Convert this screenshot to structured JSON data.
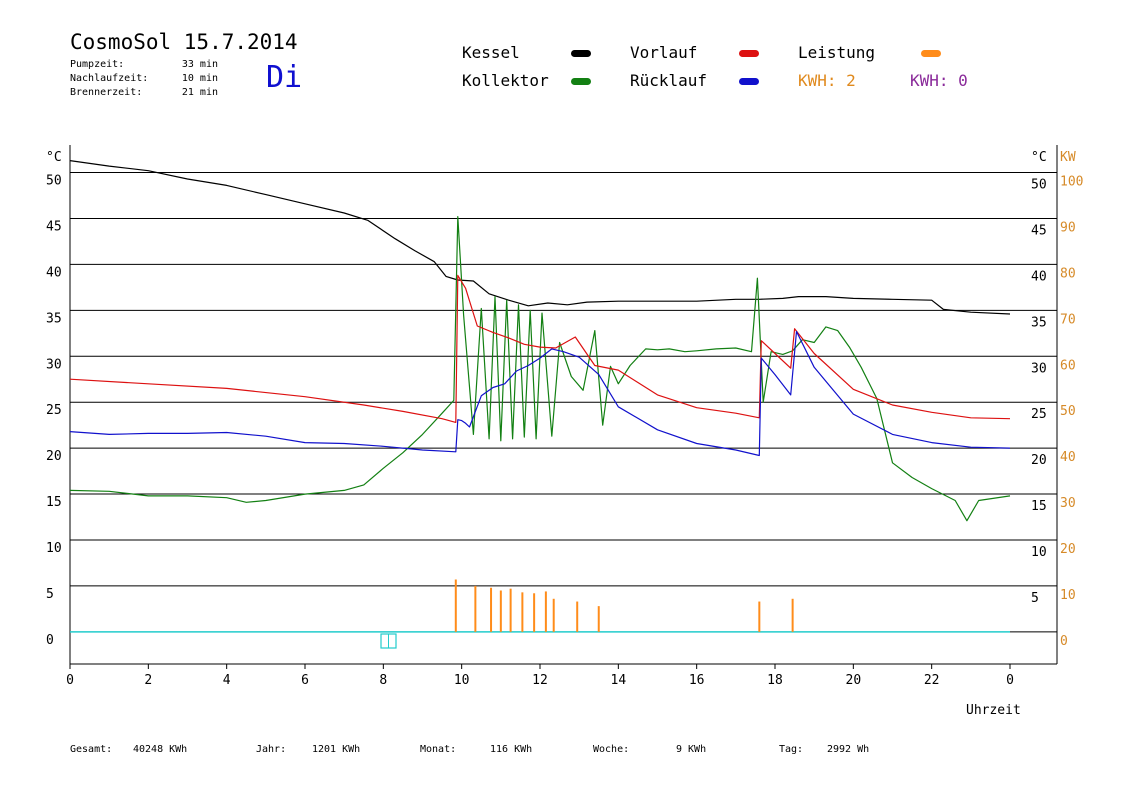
{
  "header": {
    "title": "CosmoSol 15.7.2014",
    "day": "Di",
    "stats": [
      {
        "label": "Pumpzeit:",
        "value": "33 min"
      },
      {
        "label": "Nachlaufzeit:",
        "value": "10 min"
      },
      {
        "label": "Brennerzeit:",
        "value": "21 min"
      }
    ]
  },
  "legend": {
    "items": [
      {
        "name": "Kessel",
        "color": "#000000"
      },
      {
        "name": "Kollektor",
        "color": "#138013"
      },
      {
        "name": "Vorlauf",
        "color": "#dd1111"
      },
      {
        "name": "Rücklauf",
        "color": "#1111cc"
      },
      {
        "name": "Leistung",
        "color": "#ff8c1a"
      }
    ],
    "kwh1": "KWH: 2",
    "kwh1_color": "#e08a1e",
    "kwh2": "KWH: 0",
    "kwh2_color": "#8a2a9a"
  },
  "footer": {
    "gesamt_label": "Gesamt:",
    "gesamt_value": "40248 KWh",
    "jahr_label": "Jahr:",
    "jahr_value": "1201 KWh",
    "monat_label": "Monat:",
    "monat_value": "116 KWh",
    "woche_label": "Woche:",
    "woche_value": "9 KWh",
    "tag_label": "Tag:",
    "tag_value": "2992 Wh"
  },
  "chart_data": {
    "type": "line",
    "title": "CosmoSol 15.7.2014",
    "xlabel": "Uhrzeit",
    "ylabel_left": "°C",
    "ylabel_right_1": "°C",
    "ylabel_right_2": "KW",
    "xlim": [
      0,
      24
    ],
    "ylim": [
      -3.5,
      53
    ],
    "grid": true,
    "x_ticks": [
      {
        "v": 0,
        "label": "0"
      },
      {
        "v": 2,
        "label": "2"
      },
      {
        "v": 4,
        "label": "4"
      },
      {
        "v": 6,
        "label": "6"
      },
      {
        "v": 8,
        "label": "8"
      },
      {
        "v": 10,
        "label": "10"
      },
      {
        "v": 12,
        "label": "12"
      },
      {
        "v": 14,
        "label": "14"
      },
      {
        "v": 16,
        "label": "16"
      },
      {
        "v": 18,
        "label": "18"
      },
      {
        "v": 20,
        "label": "20"
      },
      {
        "v": 22,
        "label": "22"
      },
      {
        "v": 24,
        "label": "0"
      }
    ],
    "y_left_ticks": [
      0,
      5,
      10,
      15,
      20,
      25,
      30,
      35,
      40,
      45,
      50
    ],
    "y_right_ticks": [
      5,
      10,
      15,
      20,
      25,
      30,
      35,
      40,
      45,
      50
    ],
    "kw_ticks": [
      0,
      10,
      20,
      30,
      40,
      50,
      60,
      70,
      80,
      90,
      100
    ],
    "series": [
      {
        "name": "Kessel",
        "color": "#000000",
        "x": [
          0,
          1,
          2,
          3,
          4,
          5,
          6,
          7,
          7.6,
          8.3,
          8.8,
          9.3,
          9.6,
          9.9,
          10.3,
          10.7,
          11.2,
          11.7,
          12.2,
          12.7,
          13.2,
          14,
          15,
          16,
          17,
          17.6,
          18.2,
          18.6,
          19.3,
          20,
          21,
          22,
          22.3,
          23,
          24
        ],
        "y": [
          51.3,
          50.7,
          50.2,
          49.3,
          48.6,
          47.6,
          46.6,
          45.6,
          44.8,
          42.8,
          41.5,
          40.3,
          38.7,
          38.3,
          38.2,
          36.8,
          36.1,
          35.5,
          35.8,
          35.6,
          35.9,
          36.0,
          36.0,
          36.0,
          36.2,
          36.2,
          36.3,
          36.5,
          36.5,
          36.3,
          36.2,
          36.1,
          35.1,
          34.8,
          34.6
        ]
      },
      {
        "name": "Kollektor",
        "color": "#138013",
        "x": [
          0,
          1,
          2,
          3,
          4,
          4.5,
          5,
          6,
          7,
          7.5,
          8,
          8.5,
          9,
          9.5,
          9.8,
          9.9,
          10.05,
          10.3,
          10.5,
          10.7,
          10.85,
          11,
          11.15,
          11.3,
          11.45,
          11.6,
          11.75,
          11.9,
          12.05,
          12.3,
          12.5,
          12.8,
          13.1,
          13.4,
          13.6,
          13.8,
          14,
          14.3,
          14.7,
          15,
          15.3,
          15.7,
          16,
          16.5,
          17,
          17.4,
          17.55,
          17.7,
          17.9,
          18.2,
          18.45,
          18.7,
          19,
          19.3,
          19.6,
          19.9,
          20.2,
          20.6,
          21,
          21.5,
          22,
          22.6,
          22.9,
          23.2,
          24
        ],
        "y": [
          15.4,
          15.3,
          14.8,
          14.8,
          14.6,
          14.1,
          14.3,
          15.0,
          15.4,
          16.0,
          17.8,
          19.5,
          21.5,
          23.8,
          25.2,
          45.2,
          34.5,
          21.5,
          35.2,
          21.0,
          36.5,
          20.8,
          36.1,
          21.0,
          35.6,
          21.2,
          35.0,
          21.0,
          34.7,
          21.3,
          31.5,
          27.8,
          26.3,
          32.8,
          22.5,
          28.9,
          27.0,
          29.0,
          30.8,
          30.7,
          30.8,
          30.5,
          30.6,
          30.8,
          30.9,
          30.5,
          38.5,
          25.0,
          30.5,
          30.2,
          30.6,
          31.8,
          31.5,
          33.2,
          32.8,
          31.0,
          28.8,
          25.4,
          18.4,
          16.8,
          15.6,
          14.3,
          12.1,
          14.3,
          14.8
        ]
      },
      {
        "name": "Vorlauf",
        "color": "#dd1111",
        "x": [
          0,
          2,
          4,
          6,
          7.5,
          8.5,
          9.5,
          9.85,
          9.9,
          10.1,
          10.4,
          10.8,
          11.2,
          11.6,
          12.0,
          12.4,
          12.9,
          13.4,
          14,
          15,
          16,
          17,
          17.6,
          17.65,
          18.0,
          18.4,
          18.5,
          19,
          20,
          21,
          22,
          23,
          24
        ],
        "y": [
          27.5,
          27.0,
          26.5,
          25.6,
          24.7,
          24.0,
          23.2,
          22.8,
          38.8,
          37.4,
          33.3,
          32.6,
          32.0,
          31.3,
          31.0,
          30.9,
          32.1,
          29.0,
          28.5,
          25.8,
          24.4,
          23.8,
          23.3,
          31.7,
          30.3,
          28.7,
          33.0,
          30.3,
          26.4,
          24.7,
          23.9,
          23.3,
          23.2
        ]
      },
      {
        "name": "Rücklauf",
        "color": "#1111cc",
        "x": [
          0,
          1,
          2,
          3,
          4,
          5,
          6,
          7,
          8,
          9,
          9.85,
          9.9,
          10.0,
          10.1,
          10.2,
          10.5,
          10.8,
          11.1,
          11.4,
          11.7,
          12.0,
          12.3,
          12.6,
          13.0,
          13.5,
          14,
          15,
          16,
          17,
          17.6,
          17.65,
          18.0,
          18.4,
          18.55,
          19,
          20,
          21,
          22,
          23,
          24
        ],
        "y": [
          21.8,
          21.5,
          21.6,
          21.6,
          21.7,
          21.3,
          20.6,
          20.5,
          20.2,
          19.8,
          19.6,
          23.1,
          23.0,
          22.7,
          22.3,
          25.7,
          26.6,
          27.0,
          28.4,
          29.0,
          29.8,
          30.8,
          30.5,
          29.9,
          28.0,
          24.5,
          22.0,
          20.5,
          19.8,
          19.2,
          29.8,
          28.0,
          25.8,
          32.7,
          28.8,
          23.7,
          21.5,
          20.6,
          20.1,
          20.0
        ]
      },
      {
        "name": "Leistung",
        "color": "#ff8c1a",
        "x": [
          9.85,
          10.35,
          10.75,
          11.0,
          11.25,
          11.55,
          11.85,
          12.15,
          12.35,
          12.95,
          13.5,
          17.6,
          18.45
        ],
        "y": [
          5.7,
          5.0,
          4.8,
          4.5,
          4.7,
          4.3,
          4.2,
          4.4,
          3.6,
          3.3,
          2.8,
          3.3,
          3.6
        ]
      }
    ]
  }
}
